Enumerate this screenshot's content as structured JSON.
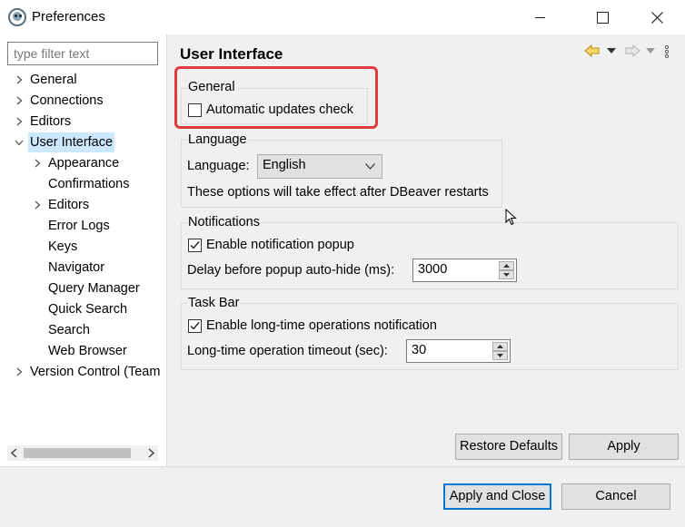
{
  "window": {
    "title": "Preferences",
    "minimize_label": "Minimize",
    "maximize_label": "Maximize",
    "close_label": "Close"
  },
  "sidebar": {
    "filter_placeholder": "type filter text",
    "items": [
      {
        "label": "General",
        "level": 0,
        "expandable": true,
        "expanded": false
      },
      {
        "label": "Connections",
        "level": 0,
        "expandable": true,
        "expanded": false
      },
      {
        "label": "Editors",
        "level": 0,
        "expandable": true,
        "expanded": false
      },
      {
        "label": "User Interface",
        "level": 0,
        "expandable": true,
        "expanded": true,
        "selected": true
      },
      {
        "label": "Appearance",
        "level": 1,
        "expandable": true,
        "expanded": false
      },
      {
        "label": "Confirmations",
        "level": 1,
        "expandable": false
      },
      {
        "label": "Editors",
        "level": 1,
        "expandable": true,
        "expanded": false
      },
      {
        "label": "Error Logs",
        "level": 1,
        "expandable": false
      },
      {
        "label": "Keys",
        "level": 1,
        "expandable": false
      },
      {
        "label": "Navigator",
        "level": 1,
        "expandable": false
      },
      {
        "label": "Query Manager",
        "level": 1,
        "expandable": false
      },
      {
        "label": "Quick Search",
        "level": 1,
        "expandable": false
      },
      {
        "label": "Search",
        "level": 1,
        "expandable": false
      },
      {
        "label": "Web Browser",
        "level": 1,
        "expandable": false
      },
      {
        "label": "Version Control (Team",
        "level": 0,
        "expandable": true,
        "expanded": false
      }
    ]
  },
  "main": {
    "title": "User Interface",
    "general": {
      "label": "General",
      "auto_updates_label": "Automatic updates check",
      "auto_updates_checked": false
    },
    "language": {
      "label": "Language",
      "field_label": "Language:",
      "selected": "English",
      "note": "These options will take effect after DBeaver restarts"
    },
    "notifications": {
      "label": "Notifications",
      "enable_label": "Enable notification popup",
      "enable_checked": true,
      "delay_label": "Delay before popup auto-hide (ms):",
      "delay_value": "3000"
    },
    "taskbar": {
      "label": "Task Bar",
      "enable_label": "Enable long-time operations notification",
      "enable_checked": true,
      "timeout_label": "Long-time operation timeout (sec):",
      "timeout_value": "30"
    },
    "restore_defaults_label": "Restore Defaults",
    "apply_label": "Apply"
  },
  "footer": {
    "apply_close_label": "Apply and Close",
    "cancel_label": "Cancel"
  },
  "colors": {
    "accent": "#0078d7",
    "selection": "#cce8ff",
    "highlight_border": "#e03c3c",
    "back_arrow": "#d4a017"
  }
}
